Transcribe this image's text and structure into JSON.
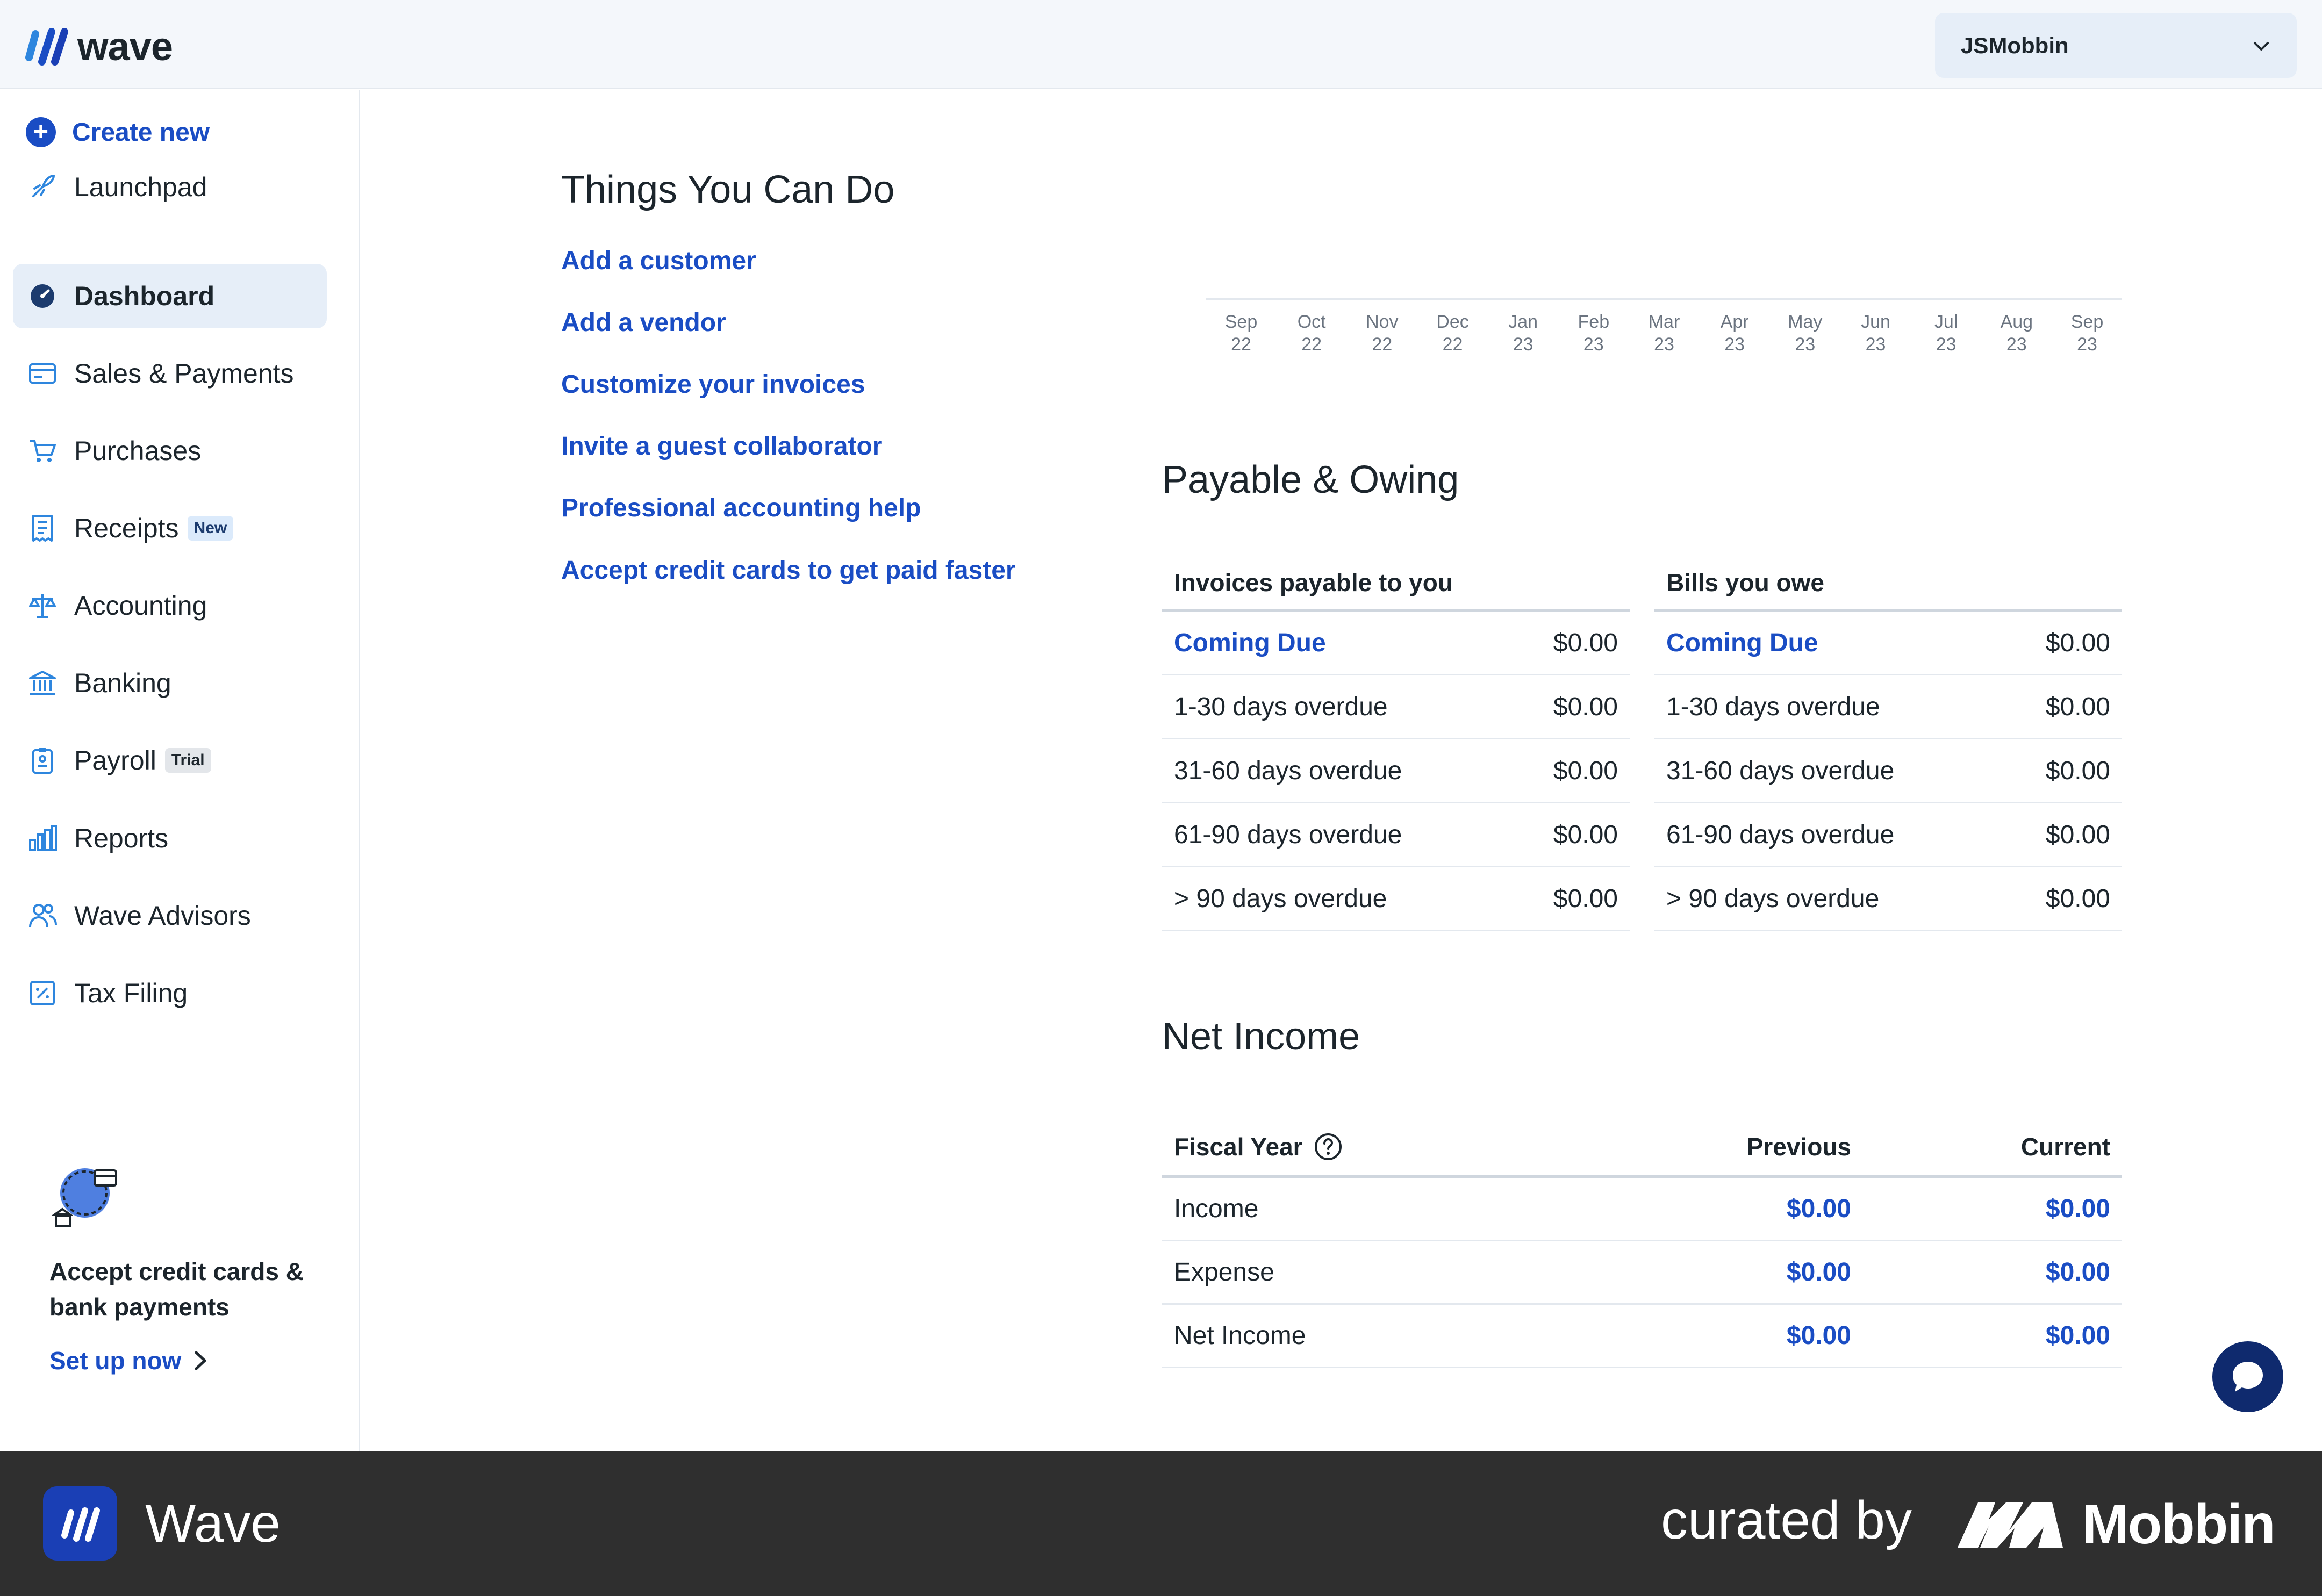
{
  "app": {
    "logo_text": "wave",
    "account_name": "JSMobbin"
  },
  "sidebar": {
    "create_new": "Create new",
    "items": [
      {
        "label": "Launchpad",
        "icon": "rocket-icon"
      },
      {
        "label": "Dashboard",
        "icon": "dashboard-icon",
        "active": true
      },
      {
        "label": "Sales & Payments",
        "icon": "card-icon"
      },
      {
        "label": "Purchases",
        "icon": "cart-icon"
      },
      {
        "label": "Receipts",
        "icon": "receipt-icon",
        "badge": "New"
      },
      {
        "label": "Accounting",
        "icon": "scale-icon"
      },
      {
        "label": "Banking",
        "icon": "bank-icon"
      },
      {
        "label": "Payroll",
        "icon": "clipboard-icon",
        "badge": "Trial"
      },
      {
        "label": "Reports",
        "icon": "bar-chart-icon"
      },
      {
        "label": "Wave Advisors",
        "icon": "people-icon"
      },
      {
        "label": "Tax Filing",
        "icon": "tax-icon"
      }
    ],
    "promo": {
      "title": "Accept credit cards & bank payments",
      "link": "Set up now"
    }
  },
  "things": {
    "title": "Things You Can Do",
    "links": [
      "Add a customer",
      "Add a vendor",
      "Customize your invoices",
      "Invite a guest collaborator",
      "Professional accounting help",
      "Accept credit cards to get paid faster"
    ]
  },
  "chart": {
    "ticks": [
      {
        "month": "Sep",
        "year": "22"
      },
      {
        "month": "Oct",
        "year": "22"
      },
      {
        "month": "Nov",
        "year": "22"
      },
      {
        "month": "Dec",
        "year": "22"
      },
      {
        "month": "Jan",
        "year": "23"
      },
      {
        "month": "Feb",
        "year": "23"
      },
      {
        "month": "Mar",
        "year": "23"
      },
      {
        "month": "Apr",
        "year": "23"
      },
      {
        "month": "May",
        "year": "23"
      },
      {
        "month": "Jun",
        "year": "23"
      },
      {
        "month": "Jul",
        "year": "23"
      },
      {
        "month": "Aug",
        "year": "23"
      },
      {
        "month": "Sep",
        "year": "23"
      }
    ]
  },
  "payable": {
    "title": "Payable & Owing",
    "invoices": {
      "header": "Invoices payable to you",
      "rows": [
        {
          "label": "Coming Due",
          "value": "$0.00"
        },
        {
          "label": "1-30 days overdue",
          "value": "$0.00"
        },
        {
          "label": "31-60 days overdue",
          "value": "$0.00"
        },
        {
          "label": "61-90 days overdue",
          "value": "$0.00"
        },
        {
          "label": "> 90 days overdue",
          "value": "$0.00"
        }
      ]
    },
    "bills": {
      "header": "Bills you owe",
      "rows": [
        {
          "label": "Coming Due",
          "value": "$0.00"
        },
        {
          "label": "1-30 days overdue",
          "value": "$0.00"
        },
        {
          "label": "31-60 days overdue",
          "value": "$0.00"
        },
        {
          "label": "61-90 days overdue",
          "value": "$0.00"
        },
        {
          "label": "> 90 days overdue",
          "value": "$0.00"
        }
      ]
    }
  },
  "net_income": {
    "title": "Net Income",
    "headers": {
      "fiscal_year": "Fiscal Year",
      "previous": "Previous",
      "current": "Current"
    },
    "rows": [
      {
        "label": "Income",
        "previous": "$0.00",
        "current": "$0.00"
      },
      {
        "label": "Expense",
        "previous": "$0.00",
        "current": "$0.00"
      },
      {
        "label": "Net Income",
        "previous": "$0.00",
        "current": "$0.00"
      }
    ]
  },
  "footer": {
    "app_name": "Wave",
    "curated_by": "curated by",
    "brand": "Mobbin"
  },
  "colors": {
    "accent": "#1a4dc4",
    "footer_bg": "#2f2f2f",
    "active_bg": "#e6eef8"
  }
}
